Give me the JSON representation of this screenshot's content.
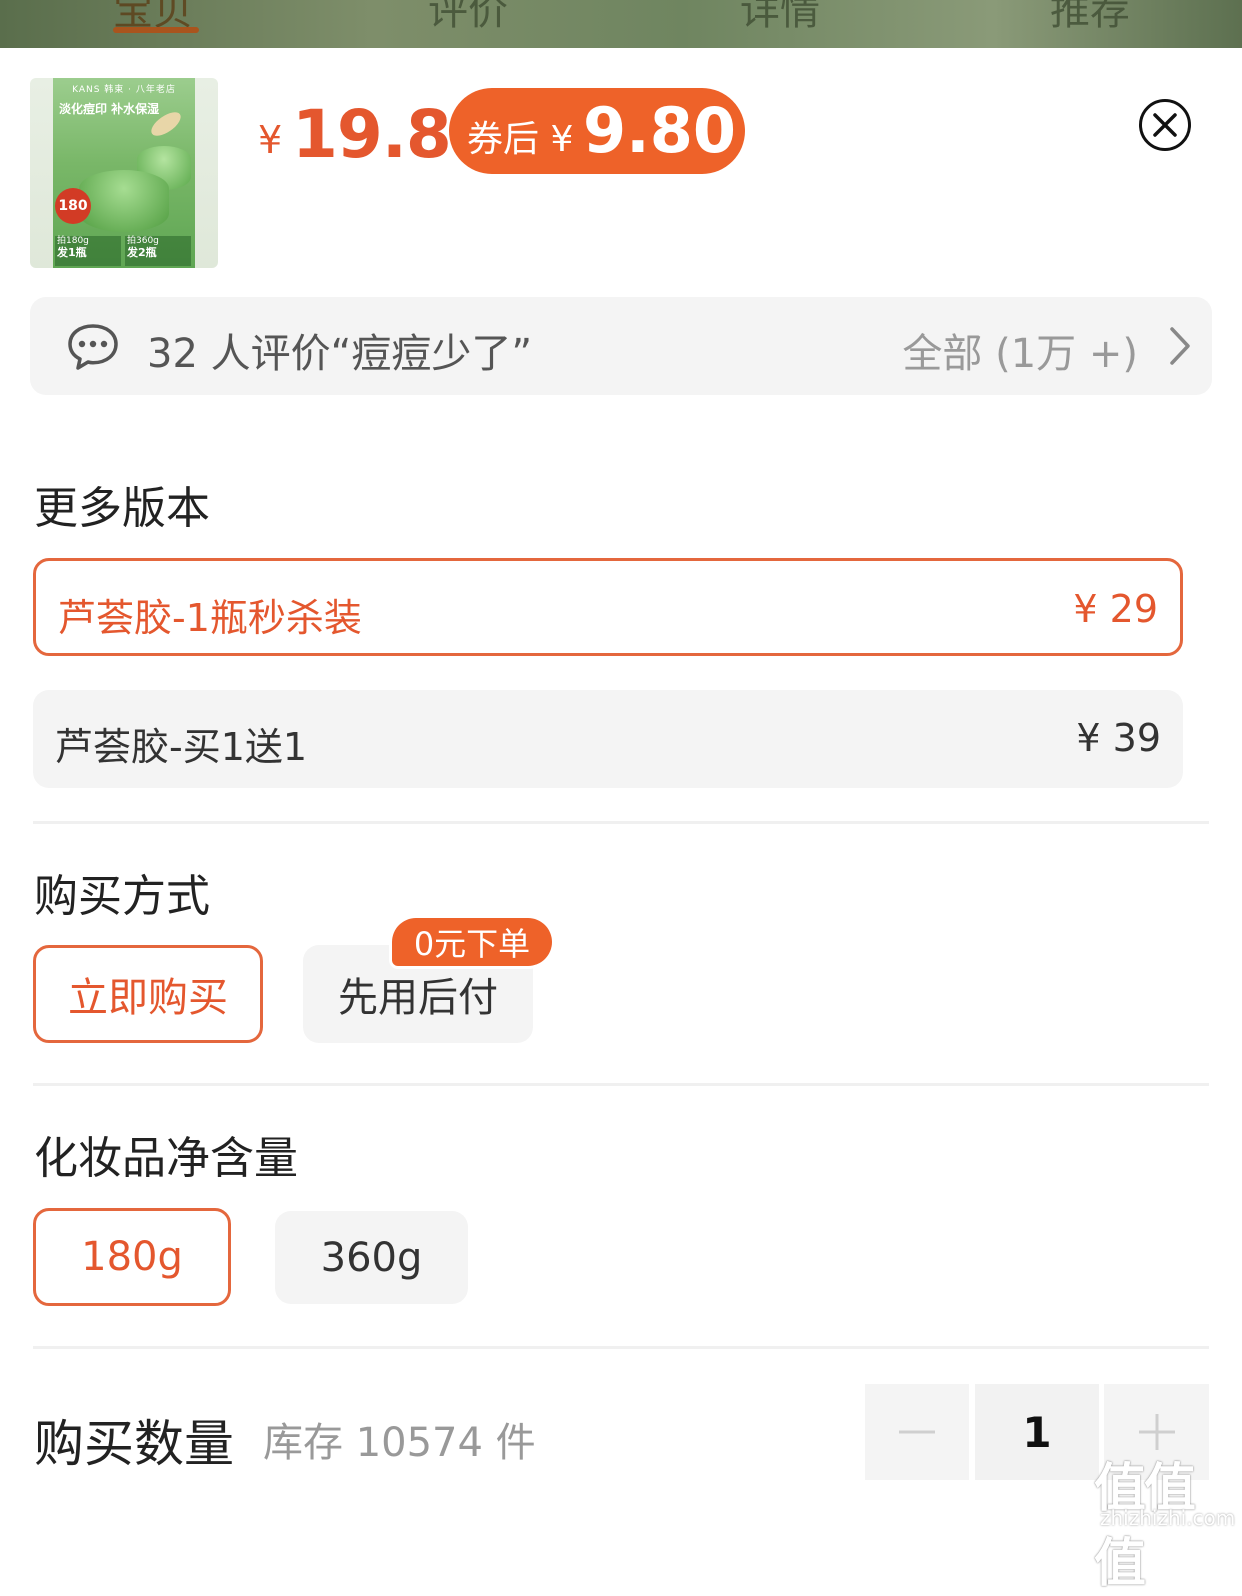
{
  "top_tabs": [
    "宝贝",
    "评价",
    "详情",
    "推荐"
  ],
  "product": {
    "thumbnail": {
      "brand": "KANS 韩束 · 八年老店",
      "slogan": "淡化痘印 补水保湿",
      "badge": "180",
      "option1_line1": "拍180g",
      "option1_line2": "发1瓶",
      "option2_line1": "拍360g",
      "option2_line2": "发2瓶"
    },
    "currency": "¥",
    "price": "19.8",
    "coupon_label": "券后 ¥",
    "coupon_price": "9.80"
  },
  "review_bar": {
    "text": "32 人评价“痘痘少了”",
    "all_link": "全部 (1万 +)"
  },
  "versions": {
    "title": "更多版本",
    "options": [
      {
        "name": "芦荟胶-1瓶秒杀装",
        "price": "¥ 29",
        "selected": true
      },
      {
        "name": "芦荟胶-买1送1",
        "price": "¥ 39",
        "selected": false
      }
    ]
  },
  "purchase_method": {
    "title": "购买方式",
    "options": [
      {
        "label": "立即购买",
        "selected": true
      },
      {
        "label": "先用后付",
        "selected": false
      }
    ],
    "tag": "0元下单"
  },
  "net_content": {
    "title": "化妆品净含量",
    "options": [
      {
        "label": "180g",
        "selected": true
      },
      {
        "label": "360g",
        "selected": false
      }
    ]
  },
  "quantity": {
    "title": "购买数量",
    "stock": "库存 10574 件",
    "value": "1"
  },
  "watermark": {
    "main": "值值值",
    "sub": "zhizhizhi.com"
  },
  "colors": {
    "accent": "#e4572e",
    "coupon_bg": "#ee6229",
    "chip_bg": "#f4f4f4"
  }
}
